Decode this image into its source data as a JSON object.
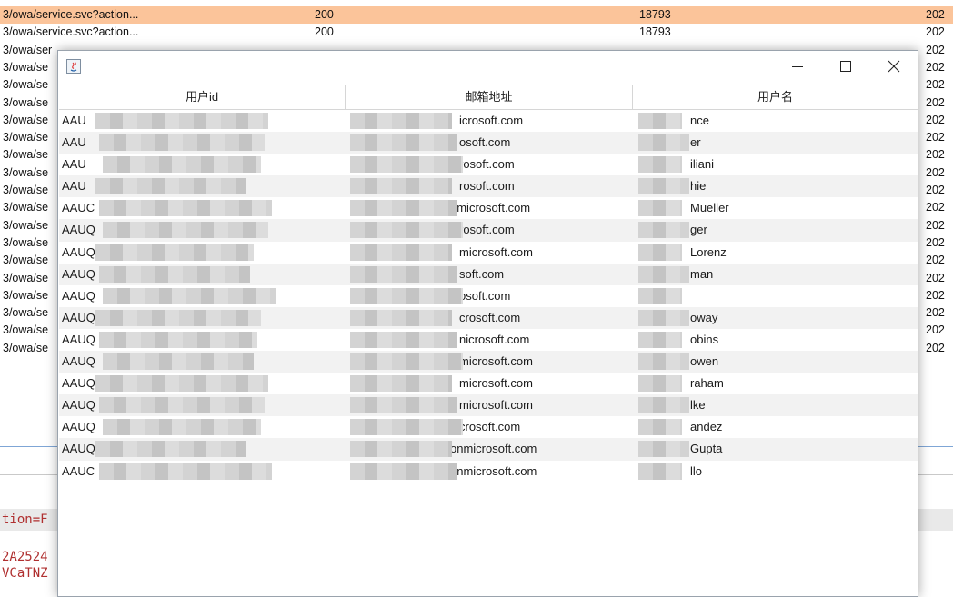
{
  "background_log": {
    "rows": [
      {
        "path": "3/owa/service.svc?action...",
        "status": "200",
        "size": "18793",
        "year": "202",
        "highlighted": true
      },
      {
        "path": "3/owa/service.svc?action...",
        "status": "200",
        "size": "18793",
        "year": "202",
        "highlighted": false
      },
      {
        "path": "3/owa/ser",
        "status": "",
        "size": "",
        "year": "202",
        "highlighted": false
      },
      {
        "path": "3/owa/se",
        "status": "",
        "size": "",
        "year": "202",
        "highlighted": false
      },
      {
        "path": "3/owa/se",
        "status": "",
        "size": "",
        "year": "202",
        "highlighted": false
      },
      {
        "path": "3/owa/se",
        "status": "",
        "size": "",
        "year": "202",
        "highlighted": false
      },
      {
        "path": "3/owa/se",
        "status": "",
        "size": "",
        "year": "202",
        "highlighted": false
      },
      {
        "path": "3/owa/se",
        "status": "",
        "size": "",
        "year": "202",
        "highlighted": false
      },
      {
        "path": "3/owa/se",
        "status": "",
        "size": "",
        "year": "202",
        "highlighted": false
      },
      {
        "path": "3/owa/se",
        "status": "",
        "size": "",
        "year": "202",
        "highlighted": false
      },
      {
        "path": "3/owa/se",
        "status": "",
        "size": "",
        "year": "202",
        "highlighted": false
      },
      {
        "path": "3/owa/se",
        "status": "",
        "size": "",
        "year": "202",
        "highlighted": false
      },
      {
        "path": "3/owa/se",
        "status": "",
        "size": "",
        "year": "202",
        "highlighted": false
      },
      {
        "path": "3/owa/se",
        "status": "",
        "size": "",
        "year": "202",
        "highlighted": false
      },
      {
        "path": "3/owa/se",
        "status": "",
        "size": "",
        "year": "202",
        "highlighted": false
      },
      {
        "path": "3/owa/se",
        "status": "",
        "size": "",
        "year": "202",
        "highlighted": false
      },
      {
        "path": "3/owa/se",
        "status": "",
        "size": "",
        "year": "202",
        "highlighted": false
      },
      {
        "path": "3/owa/se",
        "status": "",
        "size": "",
        "year": "202",
        "highlighted": false
      },
      {
        "path": "3/owa/se",
        "status": "",
        "size": "",
        "year": "202",
        "highlighted": false
      },
      {
        "path": "3/owa/se",
        "status": "",
        "size": "",
        "year": "202",
        "highlighted": false
      }
    ],
    "code_lines": [
      "tion=F",
      "2A2524",
      "VCaTNZ"
    ]
  },
  "dialog": {
    "window_controls": {
      "minimize": "—",
      "maximize": "☐",
      "close": "✕"
    },
    "columns": [
      "用户id",
      "邮箱地址",
      "用户名"
    ],
    "rows": [
      {
        "id": "AAU",
        "email": "icrosoft.com",
        "name": "nce"
      },
      {
        "id": "AAU",
        "email": "osoft.com",
        "name": "er"
      },
      {
        "id": "AAU",
        "email": "rosoft.com",
        "name": "iliani"
      },
      {
        "id": "AAU",
        "email": "rosoft.com",
        "name": "hie"
      },
      {
        "id": "AAUC",
        "email": "nmicrosoft.com",
        "name": "Mueller"
      },
      {
        "id": "AAUQ",
        "email": "rosoft.com",
        "name": "ger"
      },
      {
        "id": "AAUQ",
        "email": "microsoft.com",
        "name": "Lorenz"
      },
      {
        "id": "AAUQ",
        "email": "soft.com",
        "name": "man"
      },
      {
        "id": "AAUQ",
        "email": "osoft.com",
        "name": ""
      },
      {
        "id": "AAUQ",
        "email": "crosoft.com",
        "name": "oway"
      },
      {
        "id": "AAUQ",
        "email": "nicrosoft.com",
        "name": "obins"
      },
      {
        "id": "AAUQ",
        "email": "microsoft.com",
        "name": "owen"
      },
      {
        "id": "AAUQ",
        "email": "microsoft.com",
        "name": "raham"
      },
      {
        "id": "AAUQ",
        "email": "microsoft.com",
        "name": "lke"
      },
      {
        "id": "AAUQ",
        "email": "crosoft.com",
        "name": "andez"
      },
      {
        "id": "AAUQ",
        "email": "onmicrosoft.com",
        "name": "Gupta"
      },
      {
        "id": "AAUC",
        "email": "onmicrosoft.com",
        "name": "llo"
      }
    ]
  },
  "colors": {
    "highlight_row": "#fbc49a",
    "alt_row": "#f2f2f2",
    "code_text": "#b03030"
  }
}
